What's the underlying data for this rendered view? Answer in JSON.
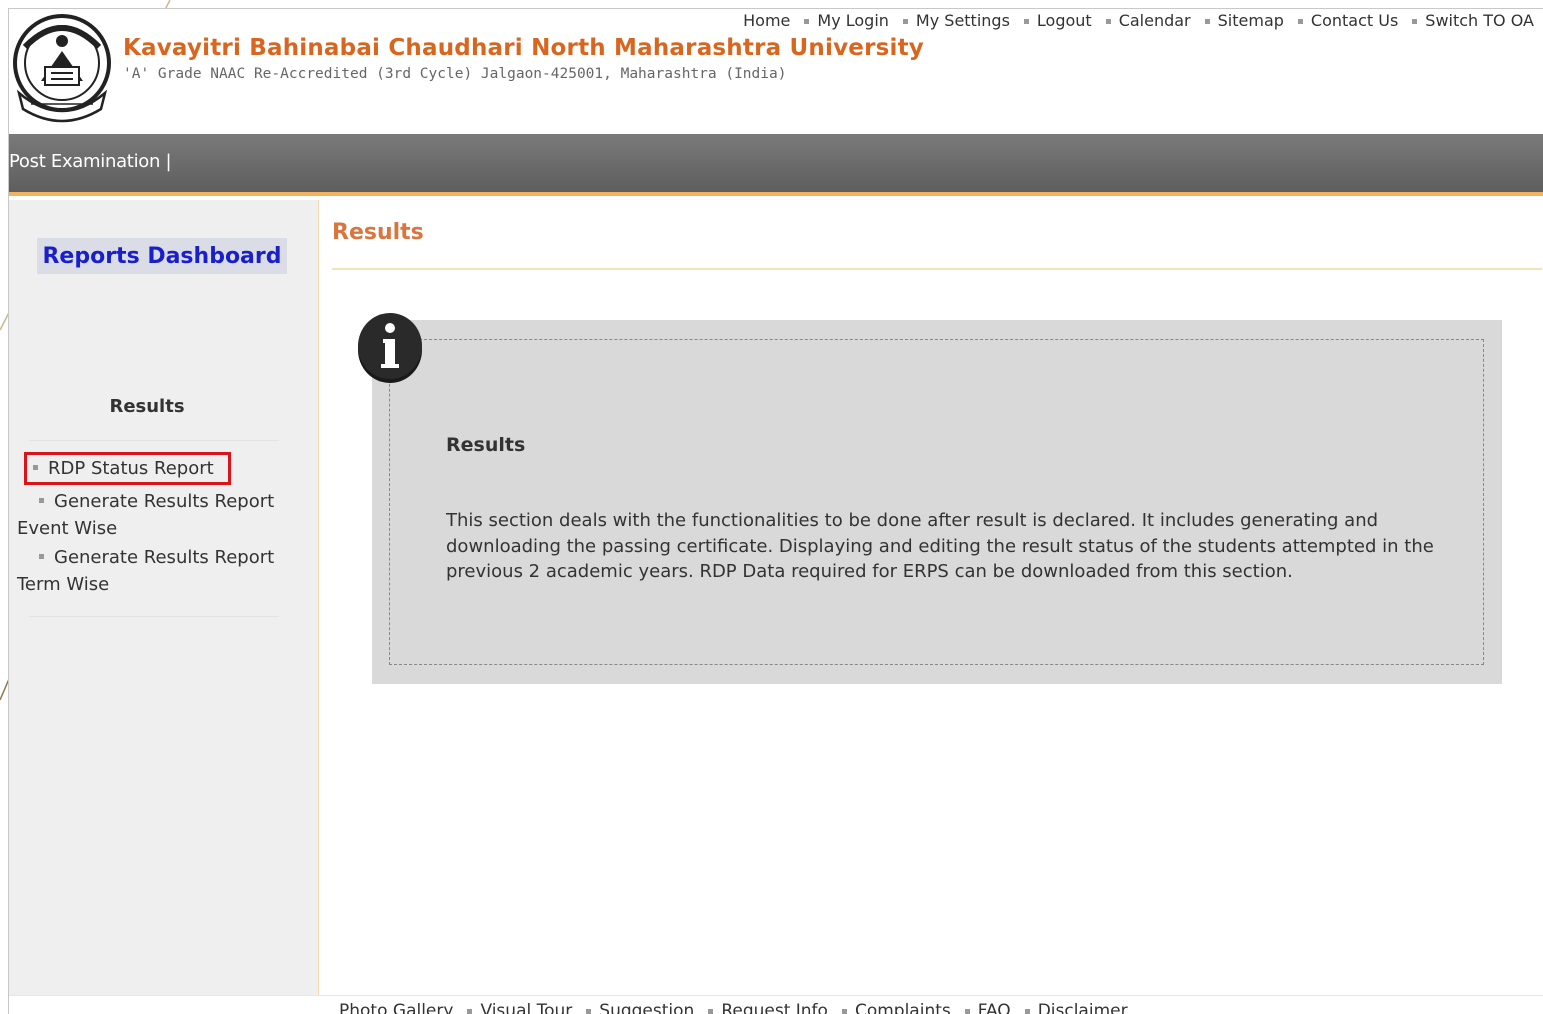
{
  "header": {
    "university_name": "Kavayitri Bahinabai Chaudhari North Maharashtra University",
    "subtitle": "'A' Grade NAAC Re-Accredited (3rd Cycle) Jalgaon-425001, Maharashtra (India)",
    "top_links": [
      "Home",
      "My Login",
      "My Settings",
      "Logout",
      "Calendar",
      "Sitemap",
      "Contact Us",
      "Switch TO OA"
    ],
    "logo_icon": "university-emblem-icon"
  },
  "navbar": {
    "item": "Post Examination |"
  },
  "sidebar": {
    "dashboard_title": "Reports Dashboard",
    "section_title": "Results",
    "items": [
      {
        "label": "RDP Status Report",
        "highlighted": true
      },
      {
        "label": "Generate Results Report Event Wise",
        "line1": "Generate Results Report",
        "line2": "Event Wise"
      },
      {
        "label": "Generate Results Report Term Wise",
        "line1": "Generate Results Report",
        "line2": "Term Wise"
      }
    ]
  },
  "main": {
    "title": "Results",
    "info": {
      "icon": "info-icon",
      "heading": "Results",
      "text": "This section deals with the functionalities to be done after result is declared. It includes generating and downloading the passing certificate. Displaying and editing the result status of the students attempted in the previous 2 academic years. RDP Data required for ERPS can be downloaded from this section."
    }
  },
  "footer": {
    "links": [
      "Photo Gallery",
      "Visual Tour",
      "Suggestion",
      "Request Info",
      "Complaints",
      "FAQ",
      "Disclaimer"
    ]
  },
  "colors": {
    "brand_orange": "#d9661f",
    "nav_gray": "#6a6a6a",
    "nav_accent": "#f2b35c",
    "highlight_red": "#d9141b",
    "dashboard_blue": "#1a1fcc"
  }
}
